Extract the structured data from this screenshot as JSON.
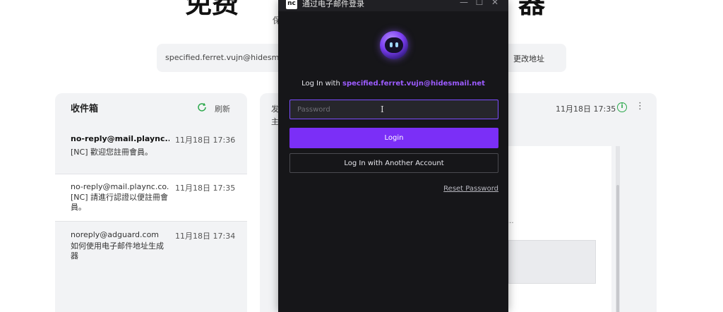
{
  "background": {
    "heading_left": "免费",
    "heading_right": "器",
    "subtitle": "保",
    "email_address": "specified.ferret.vujn@hidesmail",
    "change_address": "更改地址",
    "inbox": {
      "title": "收件箱",
      "refresh_label": "刷新",
      "items": [
        {
          "from": "no-reply@mail.plaync....",
          "date": "11月18日 17:36",
          "subject": "[NC] 歡迎您註冊會員。"
        },
        {
          "from": "no-reply@mail.plaync.co...",
          "date": "11月18日 17:35",
          "subject": "[NC] 請進行認證以便註冊會員。"
        },
        {
          "from": "noreply@adguard.com",
          "date": "11月18日 17:34",
          "subject": "如何使用电子邮件地址生成器"
        }
      ]
    },
    "detail": {
      "label_from": "发",
      "label_subject": "主",
      "date": "11月18日 17:35",
      "ellipsis": "..."
    }
  },
  "dialog": {
    "window_title": "通过电子邮件登录",
    "app_logo": "nc",
    "minimize": "—",
    "maximize": "☐",
    "close": "✕",
    "login_with_prefix": "Log In with ",
    "login_email": "specified.ferret.vujn@hidesmail.net",
    "password_placeholder": "Password",
    "login_button": "Login",
    "other_account_button": "Log In with Another Account",
    "reset_password": "Reset Password"
  },
  "colors": {
    "dialog_bg": "#161619",
    "accent_purple": "#7b2ff7",
    "email_highlight": "#9c5bff",
    "field_border": "#7c4dff",
    "refresh_green": "#2aa84a"
  }
}
